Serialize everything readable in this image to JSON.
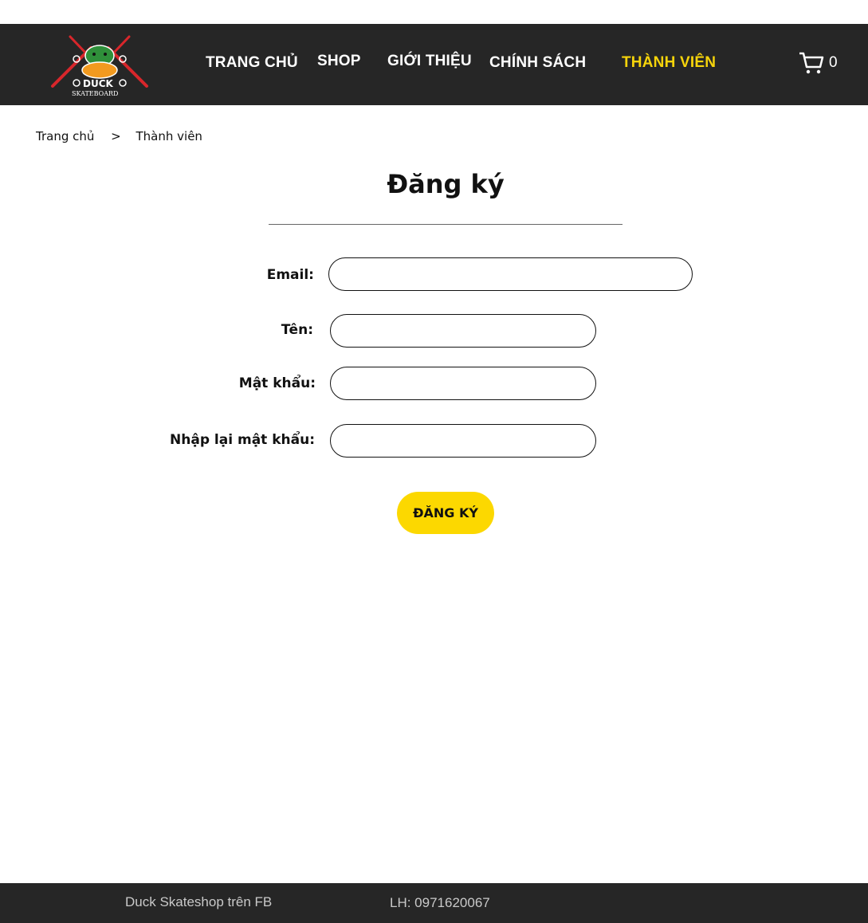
{
  "header": {
    "logo": {
      "icon": "duck-skateboard-logo",
      "brand_text": "DUCK",
      "sub_text": "SKATEBOARD"
    },
    "nav": [
      {
        "label": "TRANG CHỦ",
        "active": false
      },
      {
        "label": "SHOP",
        "active": false
      },
      {
        "label": "GIỚI THIỆU",
        "active": false
      },
      {
        "label": "CHÍNH SÁCH",
        "active": false
      },
      {
        "label": "THÀNH VIÊN",
        "active": true
      }
    ],
    "cart": {
      "icon": "cart-icon",
      "count": "0"
    }
  },
  "breadcrumb": {
    "home": "Trang chủ",
    "separator": ">",
    "current": "Thành viên"
  },
  "form": {
    "title": "Đăng ký",
    "email_label": "Email:",
    "email_value": "",
    "name_label": "Tên:",
    "name_value": "",
    "password_label": "Mật khẩu:",
    "password_value": "",
    "confirm_label": "Nhập lại mật khẩu:",
    "confirm_value": "",
    "submit_label": "ĐĂNG KÝ"
  },
  "footer": {
    "facebook_text": "Duck Skateshop trên FB",
    "contact_text": "LH: 0971620067"
  },
  "colors": {
    "header_bg": "#262626",
    "accent_yellow": "#fcd800",
    "active_nav": "#f6d40b",
    "footer_text": "#c9c9c9"
  }
}
